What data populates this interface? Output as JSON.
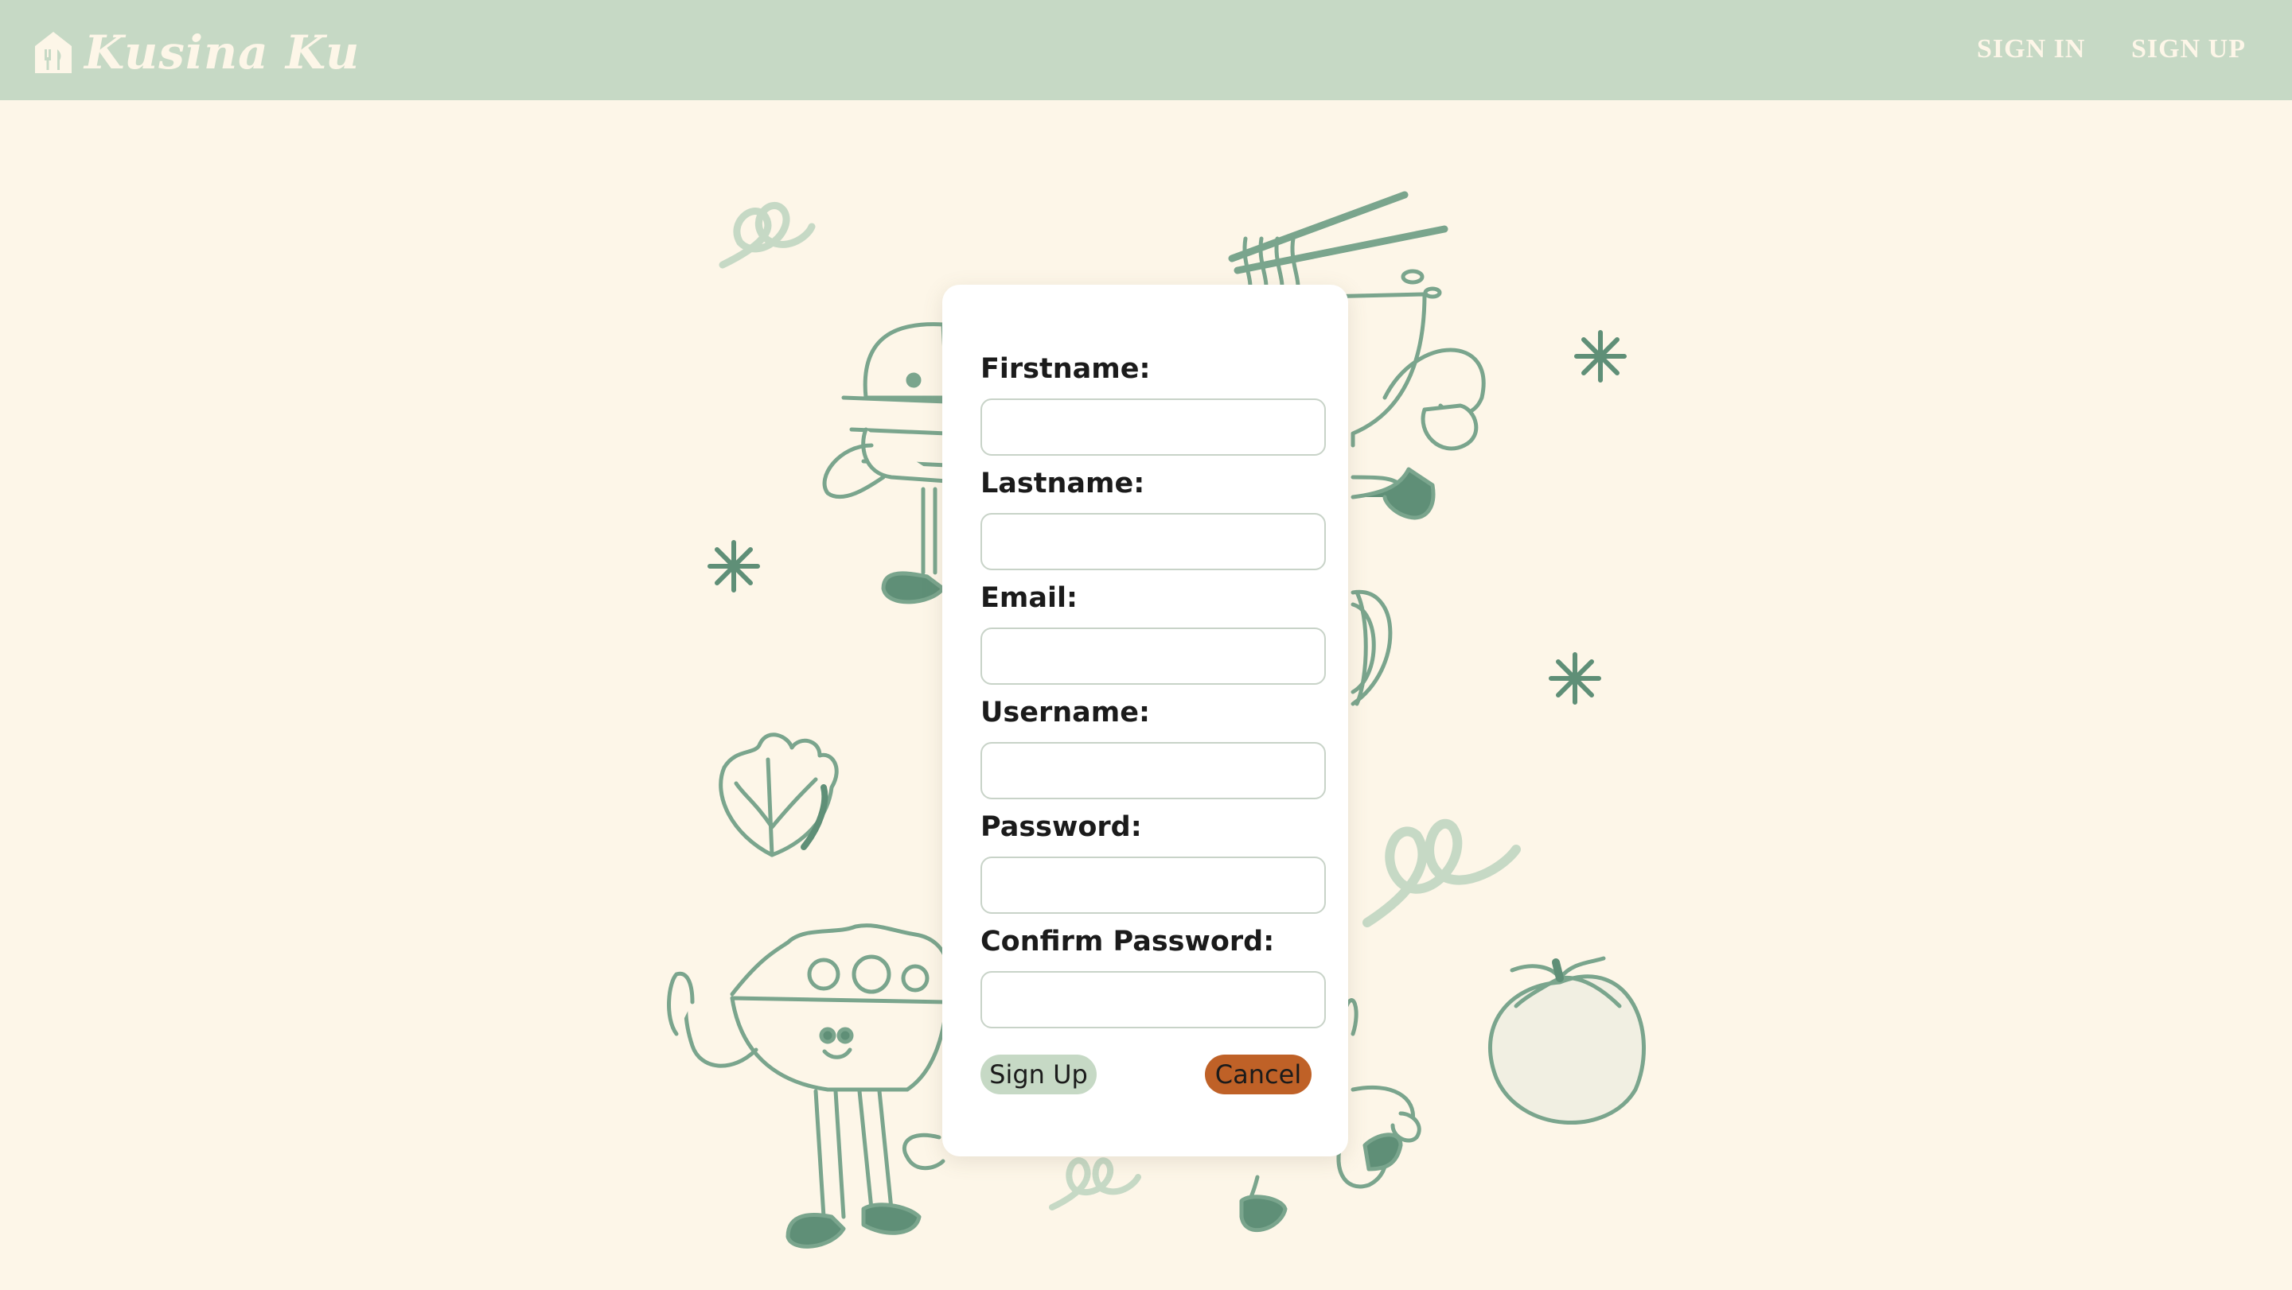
{
  "header": {
    "brand": "Kusina Ku",
    "nav": {
      "sign_in": "SIGN IN",
      "sign_up": "SIGN UP"
    }
  },
  "form": {
    "fields": [
      {
        "label": "Firstname:",
        "value": "",
        "placeholder": ""
      },
      {
        "label": "Lastname:",
        "value": "",
        "placeholder": ""
      },
      {
        "label": "Email:",
        "value": "",
        "placeholder": ""
      },
      {
        "label": "Username:",
        "value": "",
        "placeholder": ""
      },
      {
        "label": "Password:",
        "value": "",
        "placeholder": ""
      },
      {
        "label": "Confirm Password:",
        "value": "",
        "placeholder": ""
      }
    ],
    "buttons": {
      "submit": "Sign Up",
      "cancel": "Cancel"
    }
  },
  "icons": {
    "brand": "home-utensils-icon",
    "background": [
      "burger-character-illustration",
      "noodle-bowl-character-illustration",
      "lettuce-illustration",
      "salad-bowl-character-illustration",
      "onion-illustration",
      "tomato-illustration",
      "sparkle-icon",
      "swirl-doodle"
    ]
  },
  "colors": {
    "page_background": "#fdf6e8",
    "navbar": "#c6d9c5",
    "nav_text": "#fdf6e8",
    "signup_button": "#c6d9c5",
    "cancel_button": "#bf6127",
    "illustration": "#7aa58d"
  }
}
